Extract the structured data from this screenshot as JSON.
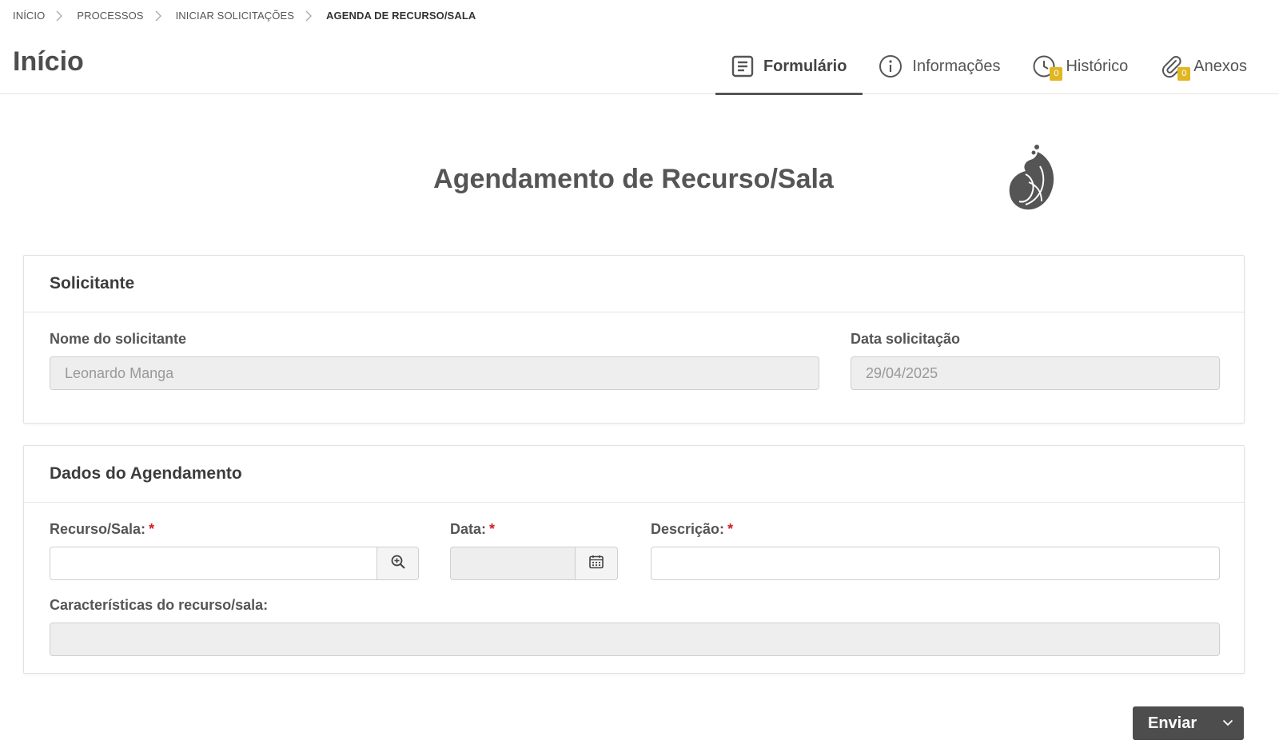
{
  "breadcrumb": {
    "items": [
      "INÍCIO",
      "PROCESSOS",
      "INICIAR SOLICITAÇÕES",
      "AGENDA DE RECURSO/SALA"
    ]
  },
  "header": {
    "title": "Início",
    "tabs": [
      {
        "label": "Formulário",
        "icon": "form-icon",
        "active": true
      },
      {
        "label": "Informações",
        "icon": "info-icon"
      },
      {
        "label": "Histórico",
        "icon": "clock-icon",
        "badge": "0"
      },
      {
        "label": "Anexos",
        "icon": "paperclip-icon",
        "badge": "0"
      }
    ]
  },
  "form": {
    "title": "Agendamento de Recurso/Sala",
    "logo": "brand-logo"
  },
  "solicitante": {
    "heading": "Solicitante",
    "nome_label": "Nome do solicitante",
    "nome_value": "Leonardo Manga",
    "data_label": "Data solicitação",
    "data_value": "29/04/2025"
  },
  "agendamento": {
    "heading": "Dados do Agendamento",
    "recurso_label": "Recurso/Sala:",
    "recurso_value": "",
    "data_label": "Data:",
    "data_value": "",
    "descricao_label": "Descrição:",
    "descricao_value": "",
    "caracteristicas_label": "Características do recurso/sala:",
    "caracteristicas_value": "",
    "required_mark": "*"
  },
  "actions": {
    "submit_label": "Enviar"
  },
  "colors": {
    "badge": "#e0b722",
    "required": "#cc2222",
    "button": "#4d4d4d"
  }
}
